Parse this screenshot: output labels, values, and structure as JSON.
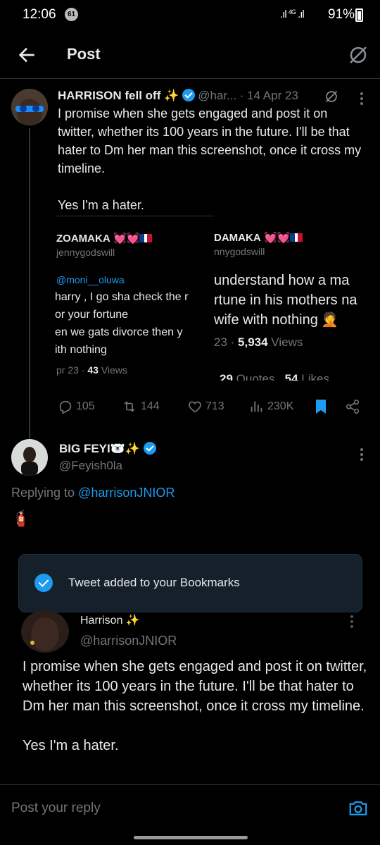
{
  "status_bar": {
    "time": "12:06",
    "notification_count": "61",
    "network": "4G",
    "battery": "91%"
  },
  "header": {
    "title": "Post"
  },
  "main_tweet": {
    "name": "HARRISON fell off ✨",
    "handle": "@har...",
    "date": "· 14 Apr 23",
    "text": "I promise when she gets engaged and post it on twitter, whether its 100 years in the future. I'll be that hater to Dm her man this screenshot, once it cross my timeline.\n\nYes I'm a hater.",
    "screenshot": {
      "left": {
        "name": "ZOAMAKA",
        "handle": "jennygodswill",
        "replying": "@moni__oluwa",
        "lines": [
          "harry , I go sha check the r",
          "or your fortune",
          "en we gats divorce then y",
          "ith nothing"
        ],
        "date": "pr 23 · ",
        "views_count": "43",
        "views_label": " Views"
      },
      "right": {
        "name": "DAMAKA",
        "handle": "nnygodswill",
        "lines": [
          "understand how a ma",
          "rtune in his mothers na",
          "wife with nothing"
        ],
        "date": "23 · ",
        "views_count": "5,934",
        "views_label": " Views",
        "quotes_count": "29",
        "quotes_label": " Quotes",
        "likes_count": "54",
        "likes_label": " Likes"
      }
    },
    "actions": {
      "replies": "105",
      "reposts": "144",
      "likes": "713",
      "views": "230K"
    }
  },
  "reply_tweet": {
    "name": "BIG FEYI🐻‍❄️✨",
    "handle": "@Feyish0la",
    "replying_prefix": "Replying to ",
    "replying_handle": "@harrisonJNIOR",
    "text": "🧯"
  },
  "toast": {
    "text": "Tweet added to your Bookmarks"
  },
  "quoted_tweet": {
    "name": "Harrison ✨",
    "handle": "@harrisonJNIOR",
    "text": "I promise when she gets engaged and post it on twitter, whether its 100 years in the future. I'll be that hater to Dm her man this screenshot, once it cross my timeline.\n\nYes I'm a hater."
  },
  "reply_bar": {
    "placeholder": "Post your reply"
  },
  "colors": {
    "background": "#000000",
    "accent": "#1d9bf0",
    "muted": "#71767b",
    "toast_bg": "#15202b"
  }
}
